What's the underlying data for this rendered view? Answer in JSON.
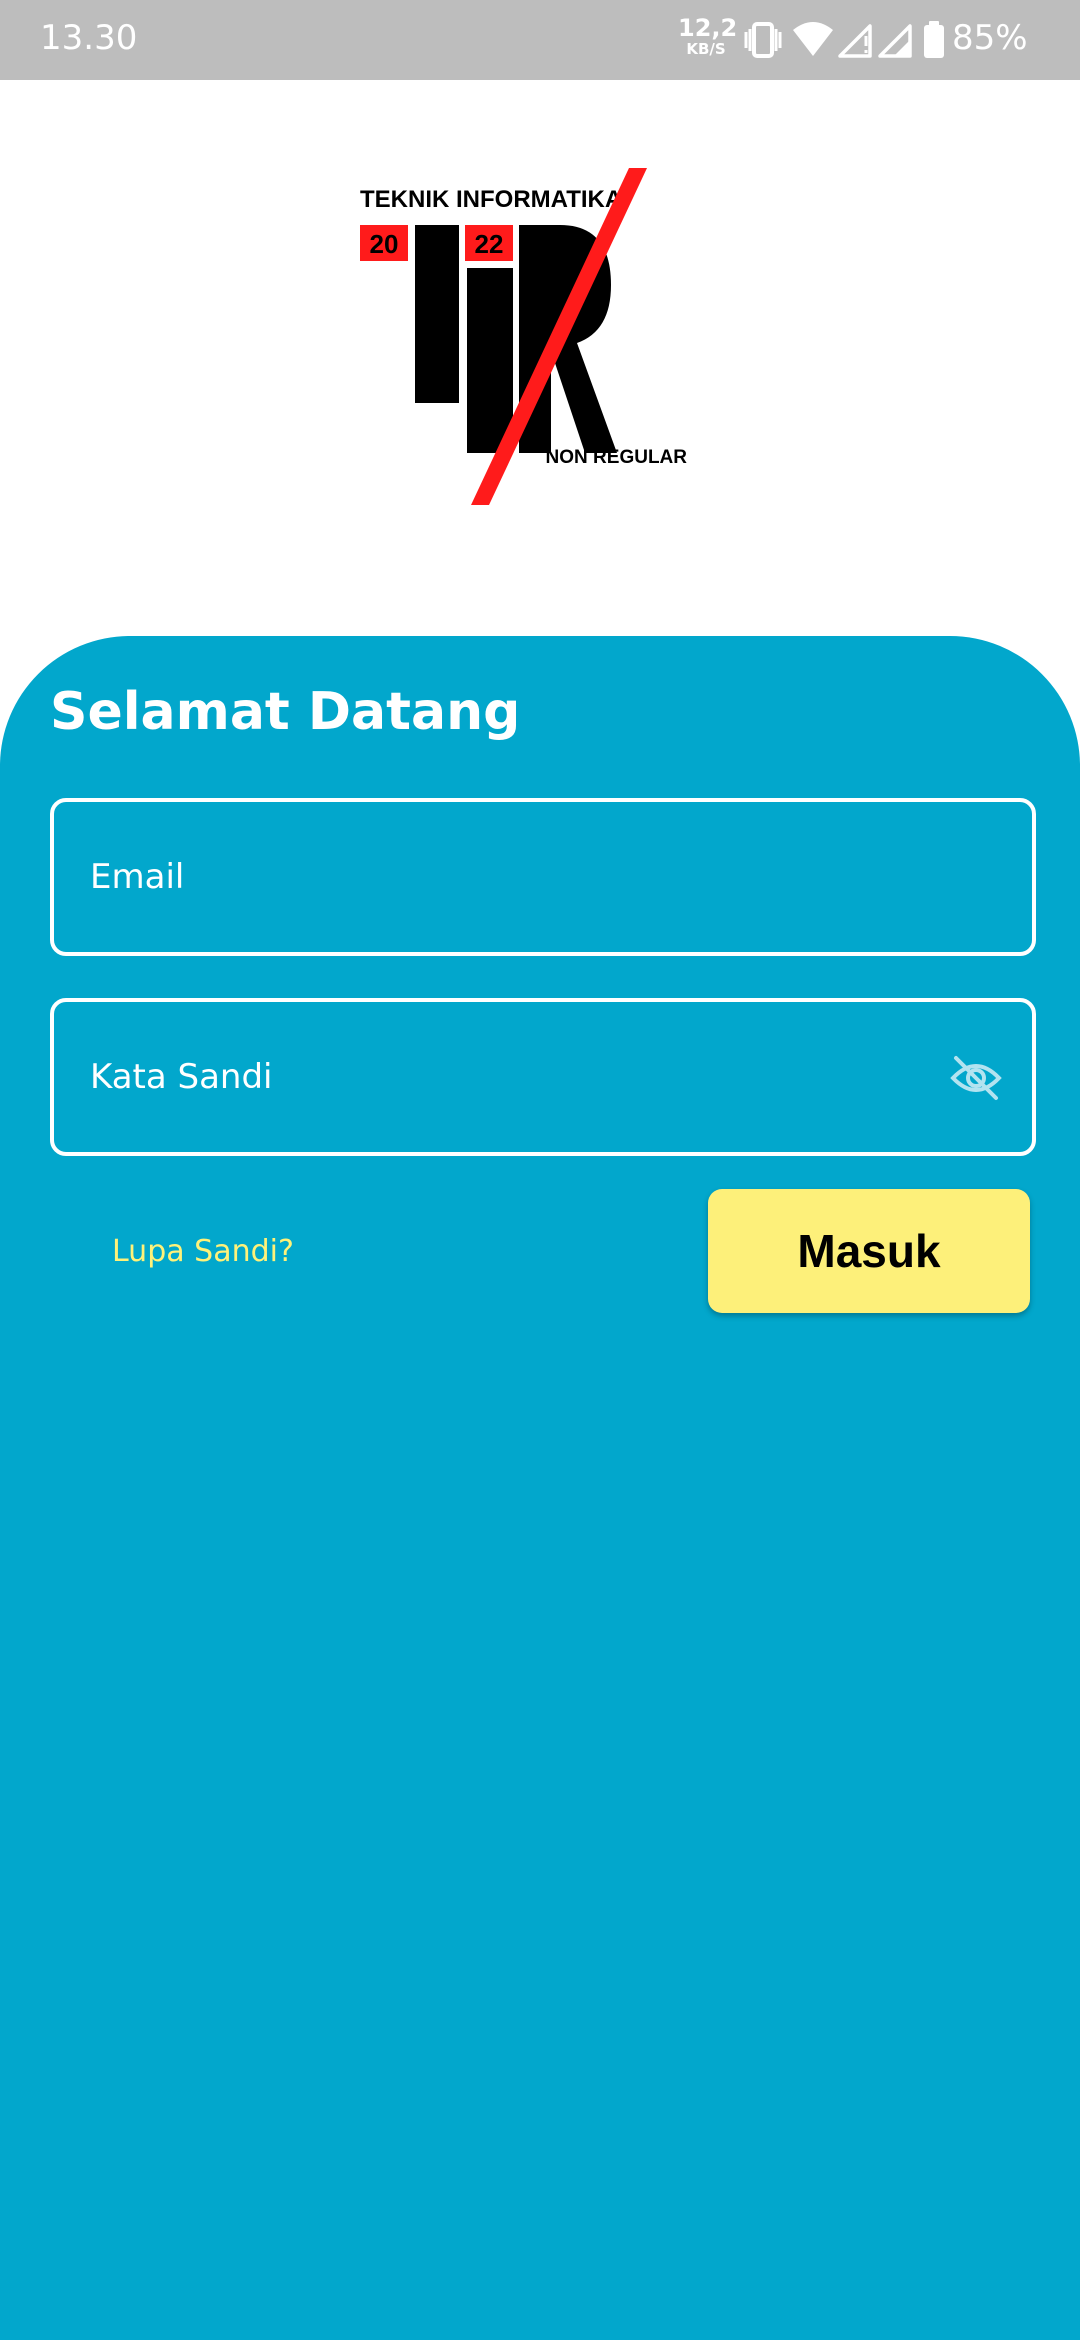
{
  "status_bar": {
    "time": "13.30",
    "net_speed_value": "12,2",
    "net_speed_unit": "KB/S",
    "battery": "85%",
    "icons": [
      "vibrate-icon",
      "wifi-icon",
      "signal-icon",
      "signal-icon",
      "battery-icon"
    ]
  },
  "logo": {
    "line1": "TEKNIK INFORMATIKA",
    "year_left": "20",
    "year_right": "22",
    "line2": "NON REGULAR"
  },
  "login": {
    "title": "Selamat Datang",
    "email_placeholder": "Email",
    "password_placeholder": "Kata Sandi",
    "password_toggle_icon": "eye-off-icon",
    "forgot_label": "Lupa Sandi?",
    "submit_label": "Masuk"
  },
  "colors": {
    "panel": "#02a7cc",
    "button": "#fdf07a",
    "link": "#fef27a",
    "status_bar": "#bdbdbd",
    "logo_accent": "#ff1b1b"
  }
}
